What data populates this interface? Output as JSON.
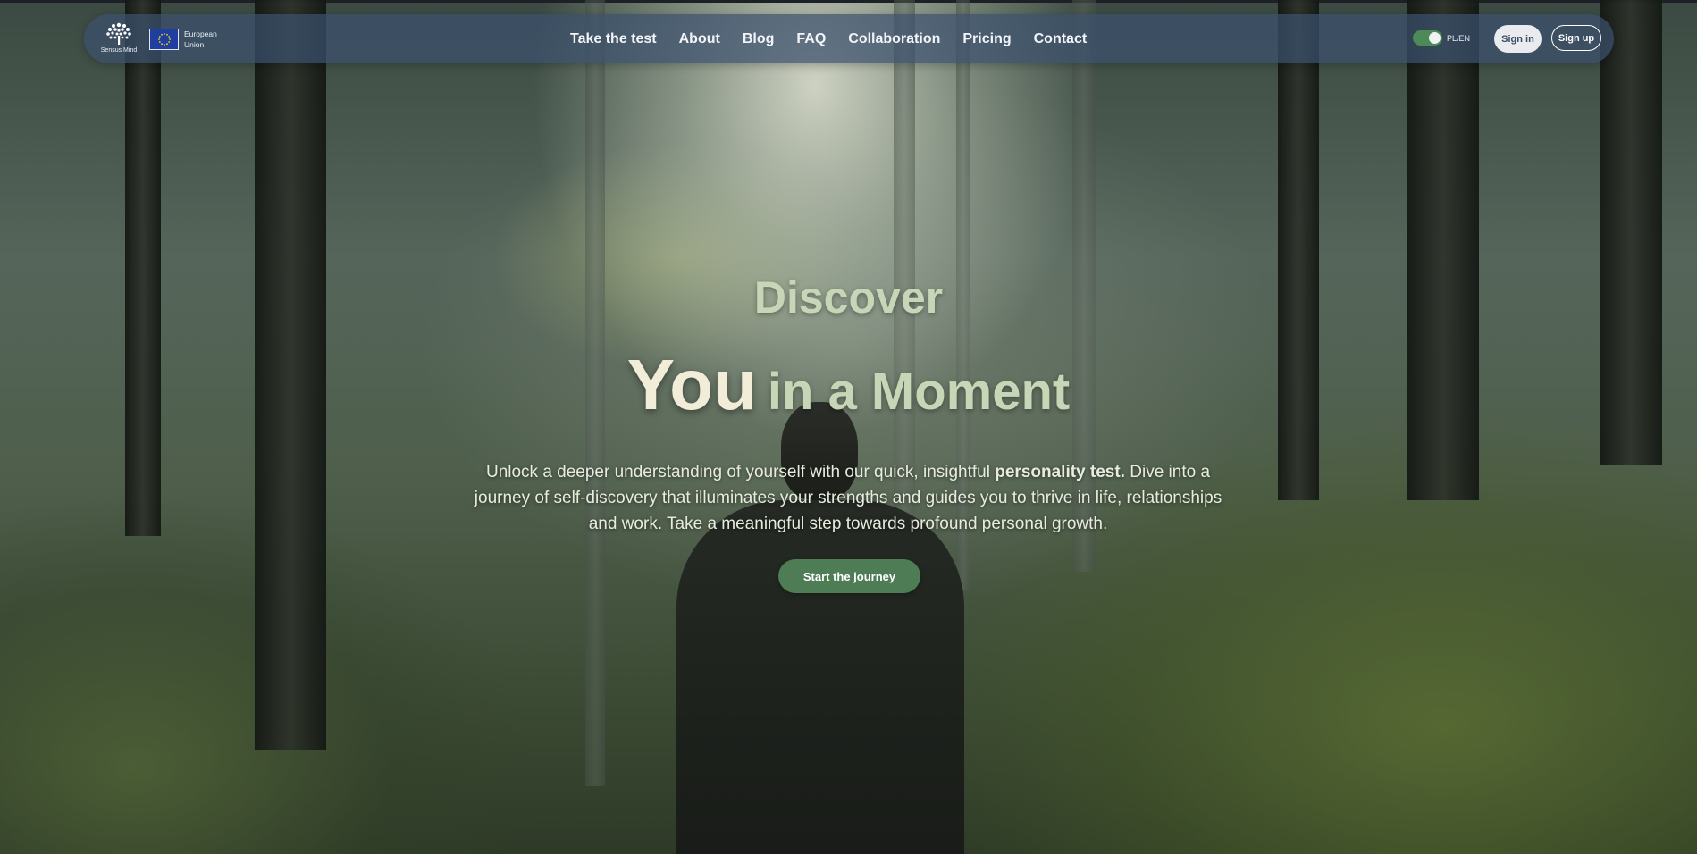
{
  "brand": {
    "logo_text": "Sensus Mind",
    "eu_label_line1": "European",
    "eu_label_line2": "Union"
  },
  "nav": {
    "items": [
      {
        "label": "Take the test"
      },
      {
        "label": "About"
      },
      {
        "label": "Blog"
      },
      {
        "label": "FAQ"
      },
      {
        "label": "Collaboration"
      },
      {
        "label": "Pricing"
      },
      {
        "label": "Contact"
      }
    ],
    "language_toggle": "PL/EN",
    "sign_in": "Sign in",
    "sign_up": "Sign up"
  },
  "hero": {
    "title_line1": "Discover",
    "title_you": "You",
    "title_rest": "in a Moment",
    "desc_part1": "Unlock a deeper understanding of yourself with our quick, insightful ",
    "desc_bold": "personality test.",
    "desc_part2": " Dive into a journey of self-discovery that illuminates your strengths and guides you to thrive in life, relationships and work. Take a meaningful step towards profound personal growth.",
    "cta": "Start the journey"
  },
  "colors": {
    "nav_bg": "#3c506e",
    "accent_green": "#4e7d55",
    "title_green": "#c7d6b6",
    "title_cream": "#f2edd8"
  }
}
